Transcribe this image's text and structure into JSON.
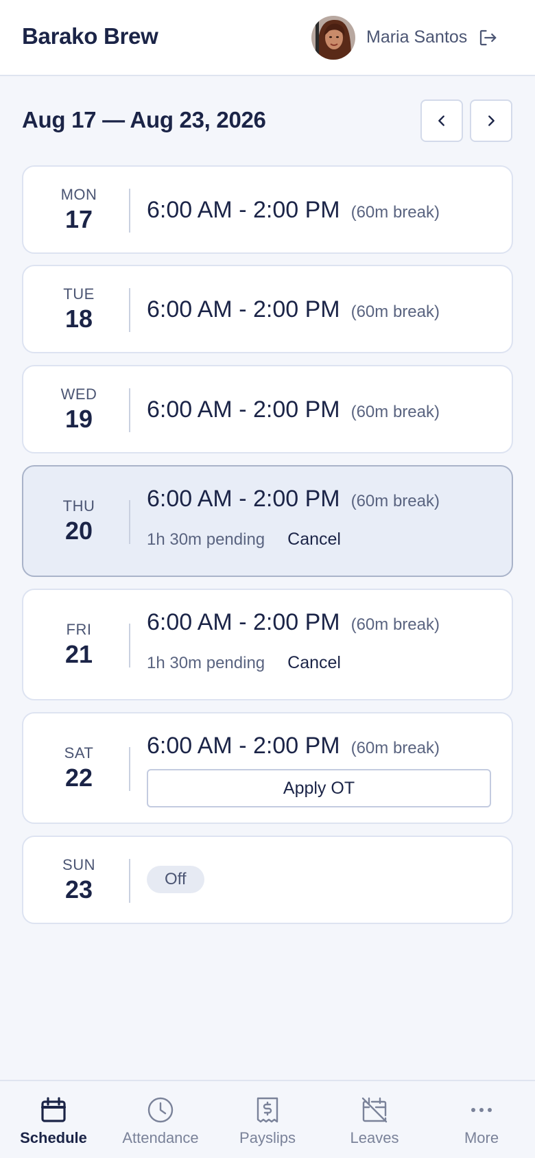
{
  "header": {
    "brand": "Barako Brew",
    "user_name": "Maria Santos",
    "logout_icon": "logout-icon"
  },
  "week": {
    "range": "Aug 17 — Aug 23, 2026",
    "prev_icon": "chevron-left-icon",
    "next_icon": "chevron-right-icon"
  },
  "days": [
    {
      "dow": "MON",
      "date": "17",
      "time": "6:00 AM - 2:00 PM",
      "break": "(60m break)"
    },
    {
      "dow": "TUE",
      "date": "18",
      "time": "6:00 AM - 2:00 PM",
      "break": "(60m break)"
    },
    {
      "dow": "WED",
      "date": "19",
      "time": "6:00 AM - 2:00 PM",
      "break": "(60m break)"
    },
    {
      "dow": "THU",
      "date": "20",
      "time": "6:00 AM - 2:00 PM",
      "break": "(60m break)",
      "pending": "1h 30m pending",
      "cancel": "Cancel",
      "selected": true
    },
    {
      "dow": "FRI",
      "date": "21",
      "time": "6:00 AM - 2:00 PM",
      "break": "(60m break)",
      "pending": "1h 30m pending",
      "cancel": "Cancel"
    },
    {
      "dow": "SAT",
      "date": "22",
      "time": "6:00 AM - 2:00 PM",
      "break": "(60m break)",
      "action": "Apply OT"
    },
    {
      "dow": "SUN",
      "date": "23",
      "status": "Off"
    }
  ],
  "bottom_nav": [
    {
      "label": "Schedule",
      "icon": "calendar-icon",
      "active": true
    },
    {
      "label": "Attendance",
      "icon": "clock-icon"
    },
    {
      "label": "Payslips",
      "icon": "receipt-dollar-icon"
    },
    {
      "label": "Leaves",
      "icon": "calendar-off-icon"
    },
    {
      "label": "More",
      "icon": "more-dots-icon"
    }
  ],
  "colors": {
    "primary": "#1b2447",
    "muted": "#7a8299",
    "background": "#f4f6fb",
    "selected_card": "#e8edf7"
  }
}
